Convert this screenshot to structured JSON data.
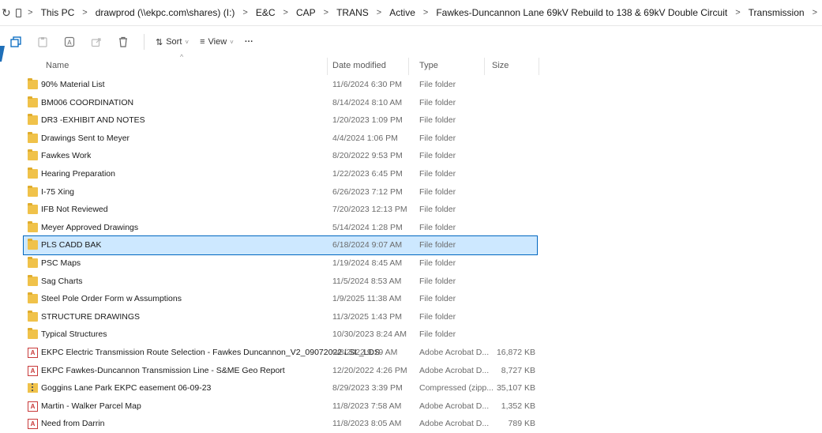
{
  "address": {
    "crumbs": [
      "This PC",
      "drawprod (\\\\ekpc.com\\shares) (I:)",
      "E&C",
      "CAP",
      "TRANS",
      "Active",
      "Fawkes-Duncannon Lane 69kV Rebuild to 138 & 69kV Double Circuit",
      "Transmission"
    ],
    "separator": ">",
    "refresh_icon": "refresh-icon",
    "pc_icon": "monitor-icon"
  },
  "toolbar": {
    "sort_label": "Sort",
    "view_label": "View",
    "more_label": "···",
    "chevron": "˅"
  },
  "columns": {
    "name": "Name",
    "date": "Date modified",
    "type": "Type",
    "size": "Size"
  },
  "files": [
    {
      "name": "90% Material List",
      "date": "11/6/2024 6:30 PM",
      "type": "File folder",
      "size": "",
      "icon": "folder"
    },
    {
      "name": "BM006 COORDINATION",
      "date": "8/14/2024 8:10 AM",
      "type": "File folder",
      "size": "",
      "icon": "folder"
    },
    {
      "name": "DR3 -EXHIBIT AND NOTES",
      "date": "1/20/2023 1:09 PM",
      "type": "File folder",
      "size": "",
      "icon": "folder"
    },
    {
      "name": "Drawings Sent to Meyer",
      "date": "4/4/2024 1:06 PM",
      "type": "File folder",
      "size": "",
      "icon": "folder"
    },
    {
      "name": "Fawkes Work",
      "date": "8/20/2022 9:53 PM",
      "type": "File folder",
      "size": "",
      "icon": "folder"
    },
    {
      "name": "Hearing Preparation",
      "date": "1/22/2023 6:45 PM",
      "type": "File folder",
      "size": "",
      "icon": "folder"
    },
    {
      "name": "I-75 Xing",
      "date": "6/26/2023 7:12 PM",
      "type": "File folder",
      "size": "",
      "icon": "folder"
    },
    {
      "name": "IFB Not Reviewed",
      "date": "7/20/2023 12:13 PM",
      "type": "File folder",
      "size": "",
      "icon": "folder"
    },
    {
      "name": "Meyer Approved Drawings",
      "date": "5/14/2024 1:28 PM",
      "type": "File folder",
      "size": "",
      "icon": "folder"
    },
    {
      "name": "PLS CADD BAK",
      "date": "6/18/2024 9:07 AM",
      "type": "File folder",
      "size": "",
      "icon": "folder",
      "selected": true
    },
    {
      "name": "PSC Maps",
      "date": "1/19/2024 8:45 AM",
      "type": "File folder",
      "size": "",
      "icon": "folder"
    },
    {
      "name": "Sag Charts",
      "date": "11/5/2024 8:53 AM",
      "type": "File folder",
      "size": "",
      "icon": "folder"
    },
    {
      "name": "Steel Pole Order Form w Assumptions",
      "date": "1/9/2025 11:38 AM",
      "type": "File folder",
      "size": "",
      "icon": "folder"
    },
    {
      "name": "STRUCTURE DRAWINGS",
      "date": "11/3/2025 1:43 PM",
      "type": "File folder",
      "size": "",
      "icon": "folder"
    },
    {
      "name": "Typical Structures",
      "date": "10/30/2023 8:24 AM",
      "type": "File folder",
      "size": "",
      "icon": "folder"
    },
    {
      "name": "EKPC Electric Transmission Route Selection - Fawkes Duncannon_V2_09072022 LSL_LDS",
      "date": "9/8/2022 9:19 AM",
      "type": "Adobe Acrobat D...",
      "size": "16,872 KB",
      "icon": "pdf"
    },
    {
      "name": "EKPC Fawkes-Duncannon Transmission Line - S&ME Geo Report",
      "date": "12/20/2022 4:26 PM",
      "type": "Adobe Acrobat D...",
      "size": "8,727 KB",
      "icon": "pdf"
    },
    {
      "name": "Goggins Lane Park EKPC easement 06-09-23",
      "date": "8/29/2023 3:39 PM",
      "type": "Compressed (zipp...",
      "size": "35,107 KB",
      "icon": "zip"
    },
    {
      "name": "Martin - Walker Parcel Map",
      "date": "11/8/2023 7:58 AM",
      "type": "Adobe Acrobat D...",
      "size": "1,352 KB",
      "icon": "pdf"
    },
    {
      "name": "Need from Darrin",
      "date": "11/8/2023 8:05 AM",
      "type": "Adobe Acrobat D...",
      "size": "789 KB",
      "icon": "pdf"
    }
  ],
  "colors": {
    "selection_bg": "#cde8ff",
    "selection_border": "#0067c0",
    "folder": "#f0c24a",
    "pdf": "#c93a3a"
  }
}
